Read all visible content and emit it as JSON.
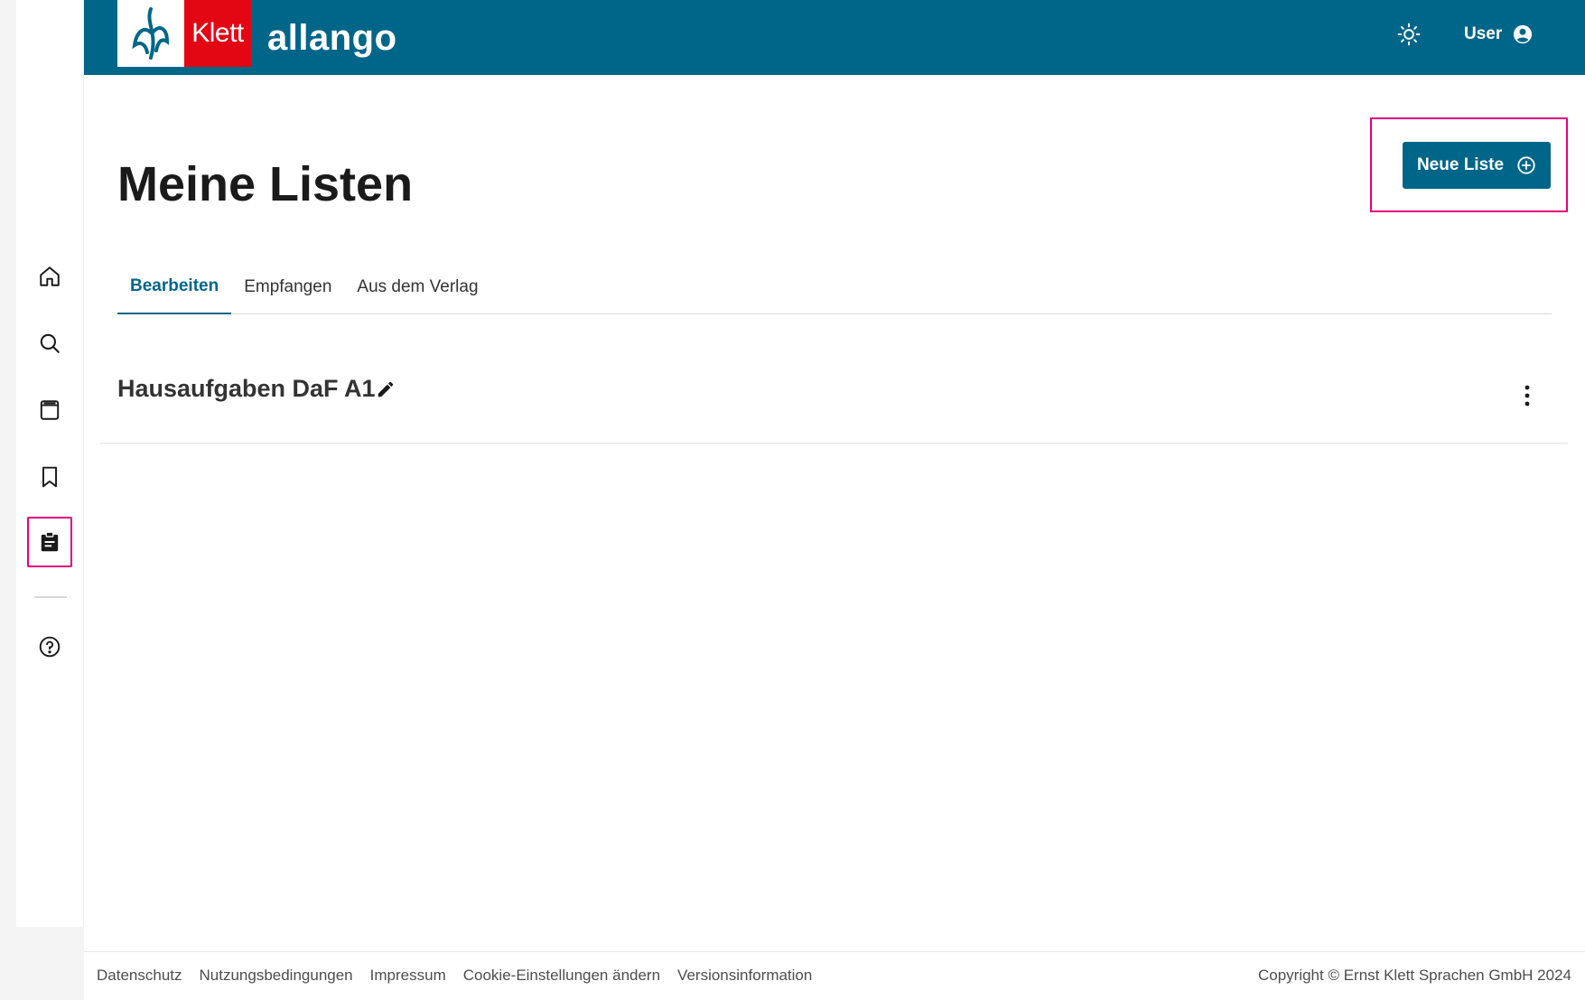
{
  "header": {
    "logo_brand": "Klett",
    "logo_product": "allango",
    "theme_icon": "sun-icon",
    "user_label": "User",
    "user_icon": "user-circle-icon",
    "background_color": "#006689"
  },
  "sidebar": {
    "items": [
      {
        "icon": "home-icon",
        "active": false
      },
      {
        "icon": "search-icon",
        "active": false
      },
      {
        "icon": "book-icon",
        "active": false
      },
      {
        "icon": "bookmark-icon",
        "active": false
      },
      {
        "icon": "clipboard-list-icon",
        "active": true
      },
      {
        "icon": "help-icon",
        "active": false
      }
    ],
    "highlight_color": "#e6007e"
  },
  "main": {
    "title": "Meine Listen",
    "new_list_label": "Neue Liste",
    "tabs": [
      {
        "label": "Bearbeiten",
        "active": true
      },
      {
        "label": "Empfangen",
        "active": false
      },
      {
        "label": "Aus dem Verlag",
        "active": false
      }
    ],
    "lists": [
      {
        "title": "Hausaufgaben DaF A1"
      }
    ]
  },
  "footer": {
    "links": [
      "Datenschutz",
      "Nutzungsbedingungen",
      "Impressum",
      "Cookie-Einstellungen ändern",
      "Versionsinformation"
    ],
    "copyright": "Copyright © Ernst Klett Sprachen GmbH 2024"
  }
}
